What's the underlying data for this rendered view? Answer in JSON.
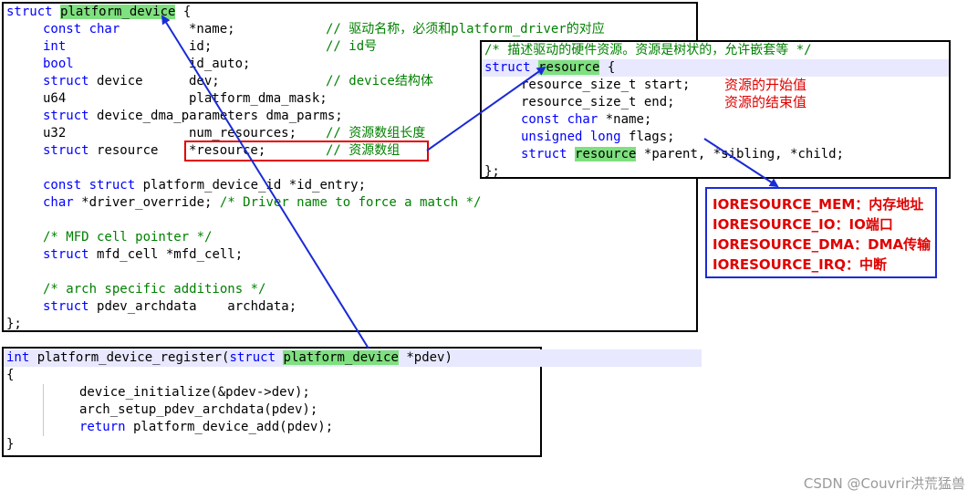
{
  "struct_platform_device": {
    "l1_kw": "struct",
    "l1_name": "platform_device",
    "l1_rest": " {",
    "l2_kw": "const char",
    "l2_code": "*name;",
    "l2_cm": "// 驱动名称，必须和platform_driver的对应",
    "l3_kw": "int",
    "l3_code": "id;",
    "l3_cm": "// id号",
    "l4_kw": "bool",
    "l4_code": "id_auto;",
    "l5_kw": "struct",
    "l5_type": "device",
    "l5_code": "dev;",
    "l5_cm": "// device结构体",
    "l6_type": "u64",
    "l6_code": "platform_dma_mask;",
    "l7_kw": "struct",
    "l7_code": "device_dma_parameters dma_parms;",
    "l8_type": "u32",
    "l8_code": "num_resources;",
    "l8_cm": "// 资源数组长度",
    "l9_kw": "struct",
    "l9_type": "resource",
    "l9_code": "*resource;",
    "l9_cm": "// 资源数组",
    "l10_kw": "const struct",
    "l10_code": "platform_device_id *id_entry;",
    "l11_kw": "char",
    "l11_code": "*driver_override;",
    "l11_cm": "/* Driver name to force a match */",
    "l12_cm": "/* MFD cell pointer */",
    "l13_kw": "struct",
    "l13_code": "mfd_cell *mfd_cell;",
    "l14_cm": "/* arch specific additions */",
    "l15_kw": "struct",
    "l15_code": "pdev_archdata    archdata;",
    "l16": "};"
  },
  "struct_resource": {
    "comment": "/* 描述驱动的硬件资源。资源是树状的，允许嵌套等 */",
    "l1_kw": "struct",
    "l1_name": "resource",
    "l1_rest": " {",
    "l2_code": "resource_size_t start;",
    "l2_note": "资源的开始值",
    "l3_code": "resource_size_t end;",
    "l3_note": "资源的结束值",
    "l4_kw": "const char",
    "l4_code": "*name;",
    "l5_kw": "unsigned long",
    "l5_code": "flags;",
    "l6_kw": "struct",
    "l6_name": "resource",
    "l6_code": "*parent, *sibling, *child;",
    "l7": "};"
  },
  "flags_note": {
    "items": [
      "IORESOURCE_MEM：内存地址",
      "IORESOURCE_IO：IO端口",
      "IORESOURCE_DMA：DMA传输",
      "IORESOURCE_IRQ：中断"
    ]
  },
  "register_func": {
    "l1_kw": "int",
    "l1_fn": "platform_device_register(",
    "l1_kw2": "struct",
    "l1_name": "platform_device",
    "l1_rest": " *pdev)",
    "l2": "{",
    "l3": "device_initialize(&pdev->dev);",
    "l4": "arch_setup_pdev_archdata(pdev);",
    "l5_kw": "return",
    "l5_code": " platform_device_add(pdev);",
    "l6": "}"
  },
  "watermark": "CSDN @Couvrir洪荒猛兽",
  "colors": {
    "keyword": "#0000ff",
    "comment": "#008000",
    "highlight": "#7fe07f",
    "annotation": "#e00000",
    "arrow": "#1a2bd6"
  }
}
